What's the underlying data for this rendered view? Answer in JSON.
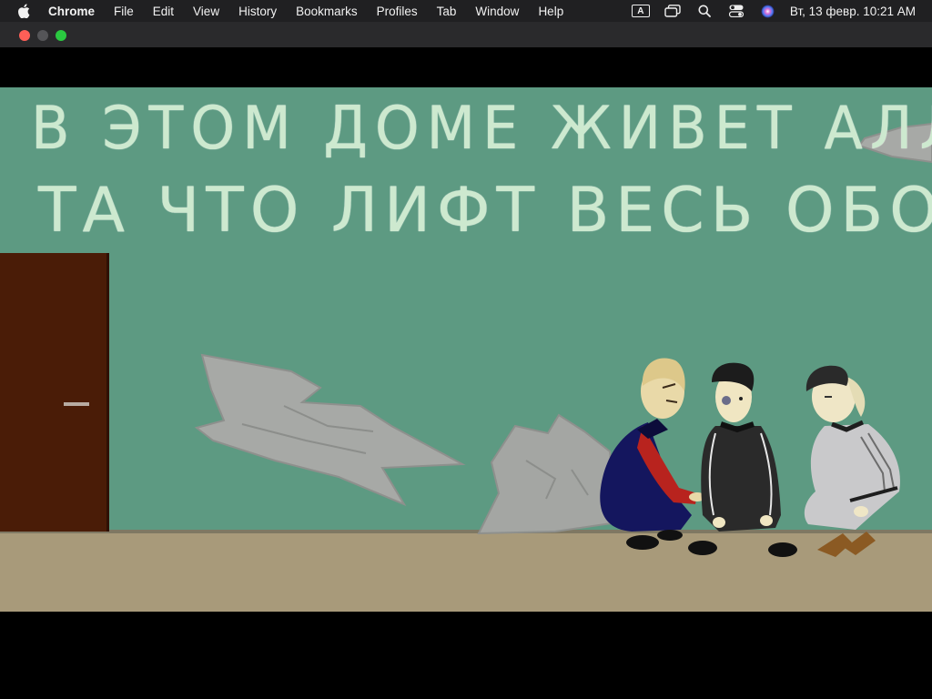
{
  "menubar": {
    "app_name": "Chrome",
    "menus": [
      "File",
      "Edit",
      "View",
      "History",
      "Bookmarks",
      "Profiles",
      "Tab",
      "Window",
      "Help"
    ],
    "input_badge": "A",
    "datetime": "Вт, 13 февр.  10:21 AM"
  },
  "video": {
    "graffiti_line1": "В ЭТОМ ДОМЕ ЖИВЕТ АЛЛА",
    "graffiti_line2": "ТА ЧТО ЛИФТ ВЕСЬ ОБОСРАЛА"
  },
  "colors": {
    "wall": "#5d9a82",
    "floor": "#a89a7a",
    "door": "#4a1c07",
    "close": "#fe5f57",
    "maximize": "#2ac840"
  }
}
